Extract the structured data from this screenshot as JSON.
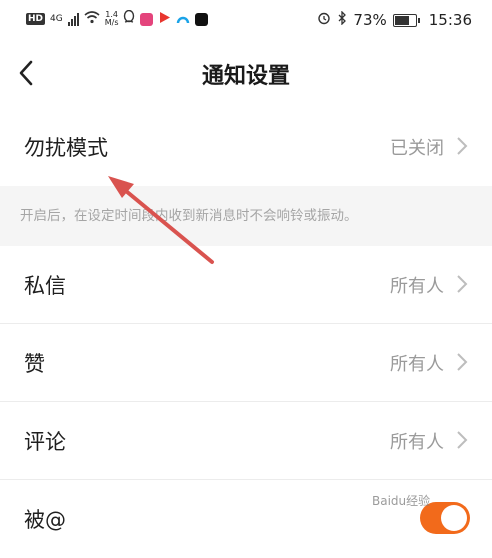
{
  "status_bar": {
    "hd": "HD",
    "network_type": "4G",
    "net_speed_value": "1.4",
    "net_speed_unit": "M/s",
    "battery_percent": "73%",
    "battery_level": 0.73,
    "time": "15:36"
  },
  "header": {
    "title": "通知设置"
  },
  "settings": {
    "dnd": {
      "label": "勿扰模式",
      "value": "已关闭"
    },
    "dnd_hint": "开启后，在设定时间段内收到新消息时不会响铃或振动。",
    "messages": {
      "label": "私信",
      "value": "所有人"
    },
    "likes": {
      "label": "赞",
      "value": "所有人"
    },
    "comments": {
      "label": "评论",
      "value": "所有人"
    },
    "mentions": {
      "label": "被@",
      "enabled": true
    }
  },
  "colors": {
    "accent": "#f26a1b",
    "annotation_arrow": "#d9534f"
  },
  "watermark": "Baidu经验"
}
